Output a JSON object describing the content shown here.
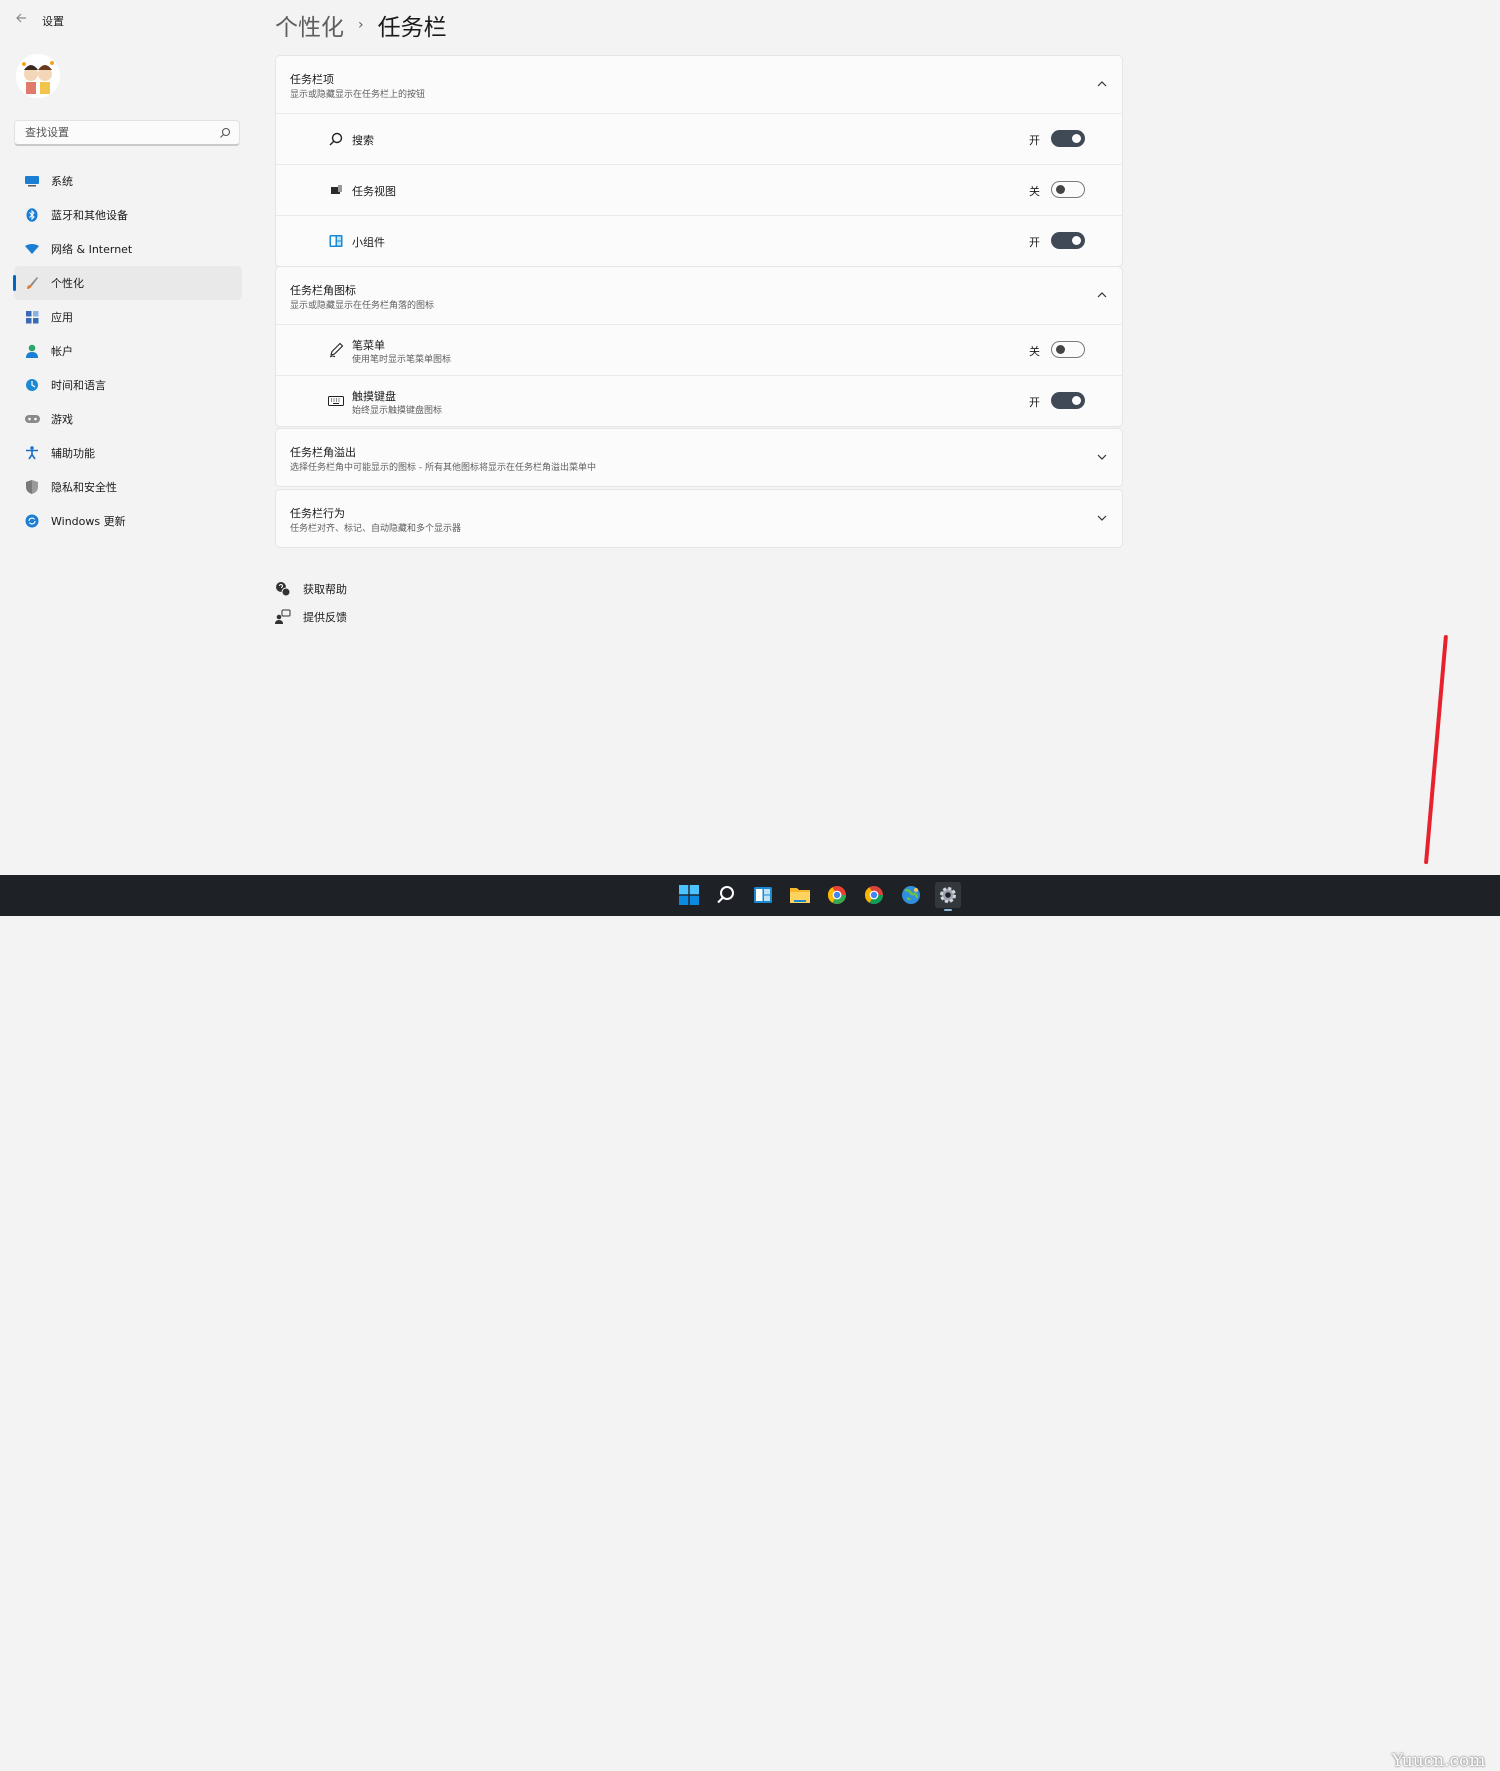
{
  "titlebar": {
    "app_title": "设置"
  },
  "search": {
    "placeholder": "查找设置"
  },
  "sidebar": {
    "items": [
      {
        "label": "系统",
        "icon": "system-icon",
        "color": "#0078d4"
      },
      {
        "label": "蓝牙和其他设备",
        "icon": "bluetooth-icon",
        "color": "#0078d4"
      },
      {
        "label": "网络 & Internet",
        "icon": "wifi-icon",
        "color": "#0078d4"
      },
      {
        "label": "个性化",
        "icon": "brush-icon",
        "color": "#e17c2e",
        "active": true
      },
      {
        "label": "应用",
        "icon": "apps-icon",
        "color": "#3c6bb6"
      },
      {
        "label": "帐户",
        "icon": "account-icon",
        "color": "#2aa56b"
      },
      {
        "label": "时间和语言",
        "icon": "time-language-icon",
        "color": "#1a8ad4"
      },
      {
        "label": "游戏",
        "icon": "game-icon",
        "color": "#7a7a7a"
      },
      {
        "label": "辅助功能",
        "icon": "accessibility-icon",
        "color": "#1a6fc4"
      },
      {
        "label": "隐私和安全性",
        "icon": "shield-icon",
        "color": "#8a8a8a"
      },
      {
        "label": "Windows 更新",
        "icon": "update-icon",
        "color": "#0078d4"
      }
    ]
  },
  "breadcrumb": {
    "parent": "个性化",
    "separator": "›",
    "current": "任务栏"
  },
  "taskbar_items": {
    "title": "任务栏项",
    "subtitle": "显示或隐藏显示在任务栏上的按钮",
    "rows": [
      {
        "label": "搜索",
        "state": "开",
        "on": true
      },
      {
        "label": "任务视图",
        "state": "关",
        "on": false
      },
      {
        "label": "小组件",
        "state": "开",
        "on": true
      }
    ]
  },
  "corner_icons": {
    "title": "任务栏角图标",
    "subtitle": "显示或隐藏显示在任务栏角落的图标",
    "rows": [
      {
        "label": "笔菜单",
        "sub": "使用笔时显示笔菜单图标",
        "state": "关",
        "on": false
      },
      {
        "label": "触摸键盘",
        "sub": "始终显示触摸键盘图标",
        "state": "开",
        "on": true
      }
    ]
  },
  "corner_overflow": {
    "title": "任务栏角溢出",
    "subtitle": "选择任务栏角中可能显示的图标 - 所有其他图标将显示在任务栏角溢出菜单中"
  },
  "behaviors": {
    "title": "任务栏行为",
    "subtitle": "任务栏对齐、标记、自动隐藏和多个显示器"
  },
  "links": {
    "help": "获取帮助",
    "feedback": "提供反馈"
  },
  "watermark": "Yuucn.com",
  "colors": {
    "accent": "#0067c0",
    "toggle_on": "#3f4a56",
    "taskbar": "#1e2226"
  }
}
